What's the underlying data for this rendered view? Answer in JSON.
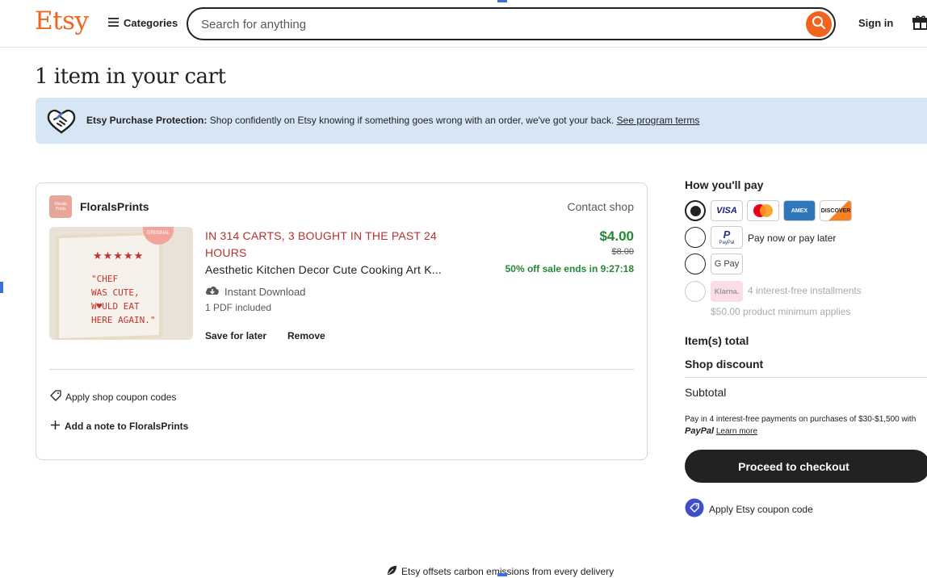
{
  "header": {
    "logo": "Etsy",
    "categories_label": "Categories",
    "search_placeholder": "Search for anything",
    "sign_in": "Sign in"
  },
  "page": {
    "title": "1 item in your cart"
  },
  "protection_banner": {
    "bold": "Etsy Purchase Protection:",
    "text": " Shop confidently on Etsy knowing if something goes wrong with an order, we've got your back. ",
    "link": "See program terms"
  },
  "cart": {
    "shop_avatar_text": "Florals Prints",
    "shop_name": "FloralsPrints",
    "contact_shop": "Contact shop",
    "item": {
      "demand_label": "IN 314 CARTS, 3 BOUGHT IN THE PAST 24 HOURS",
      "title": "Aesthetic Kitchen Decor Cute Cooking Art K...",
      "delivery": "Instant Download",
      "included": "1 PDF included",
      "save_for_later": "Save for later",
      "remove": "Remove",
      "price": "$4.00",
      "original_price": "$8.00",
      "sale_text": "50% off sale ends in 9:27:18",
      "image_stars": "★★★★★",
      "image_quote": "\"CHEF\nWAS CUTE,\nW♥ULD EAT\nHERE AGAIN.\"",
      "image_stamp": "ORIGINAL"
    },
    "apply_shop_coupon": "Apply shop coupon codes",
    "add_note": "Add a note to FloralsPrints"
  },
  "payment": {
    "heading": "How you'll pay",
    "card_logos": [
      "VISA",
      "Mastercard",
      "AMEX",
      "DISCOVER"
    ],
    "paypal_label": "Pay now or pay later",
    "paypal_logo_text": "PayPal",
    "gpay_label": "G Pay",
    "klarna_logo": "Klarna.",
    "klarna_label": "4 interest-free installments",
    "klarna_min": "$50.00 product minimum applies"
  },
  "summary": {
    "items_total": "Item(s) total",
    "shop_discount": "Shop discount",
    "subtotal": "Subtotal",
    "paypal_note_1": "Pay in 4 interest-free payments on purchases of $30-$1,500 with ",
    "paypal_note_brand": "PayPal",
    "paypal_note_link": "Learn more",
    "checkout_button": "Proceed to checkout",
    "apply_etsy_coupon": "Apply Etsy coupon code"
  },
  "footer": {
    "carbon": "Etsy offsets carbon emissions from every delivery"
  },
  "colors": {
    "brand": "#f1641e",
    "price_green": "#258635",
    "demand_red": "#b7322c",
    "banner_bg": "#d7e6f5"
  }
}
